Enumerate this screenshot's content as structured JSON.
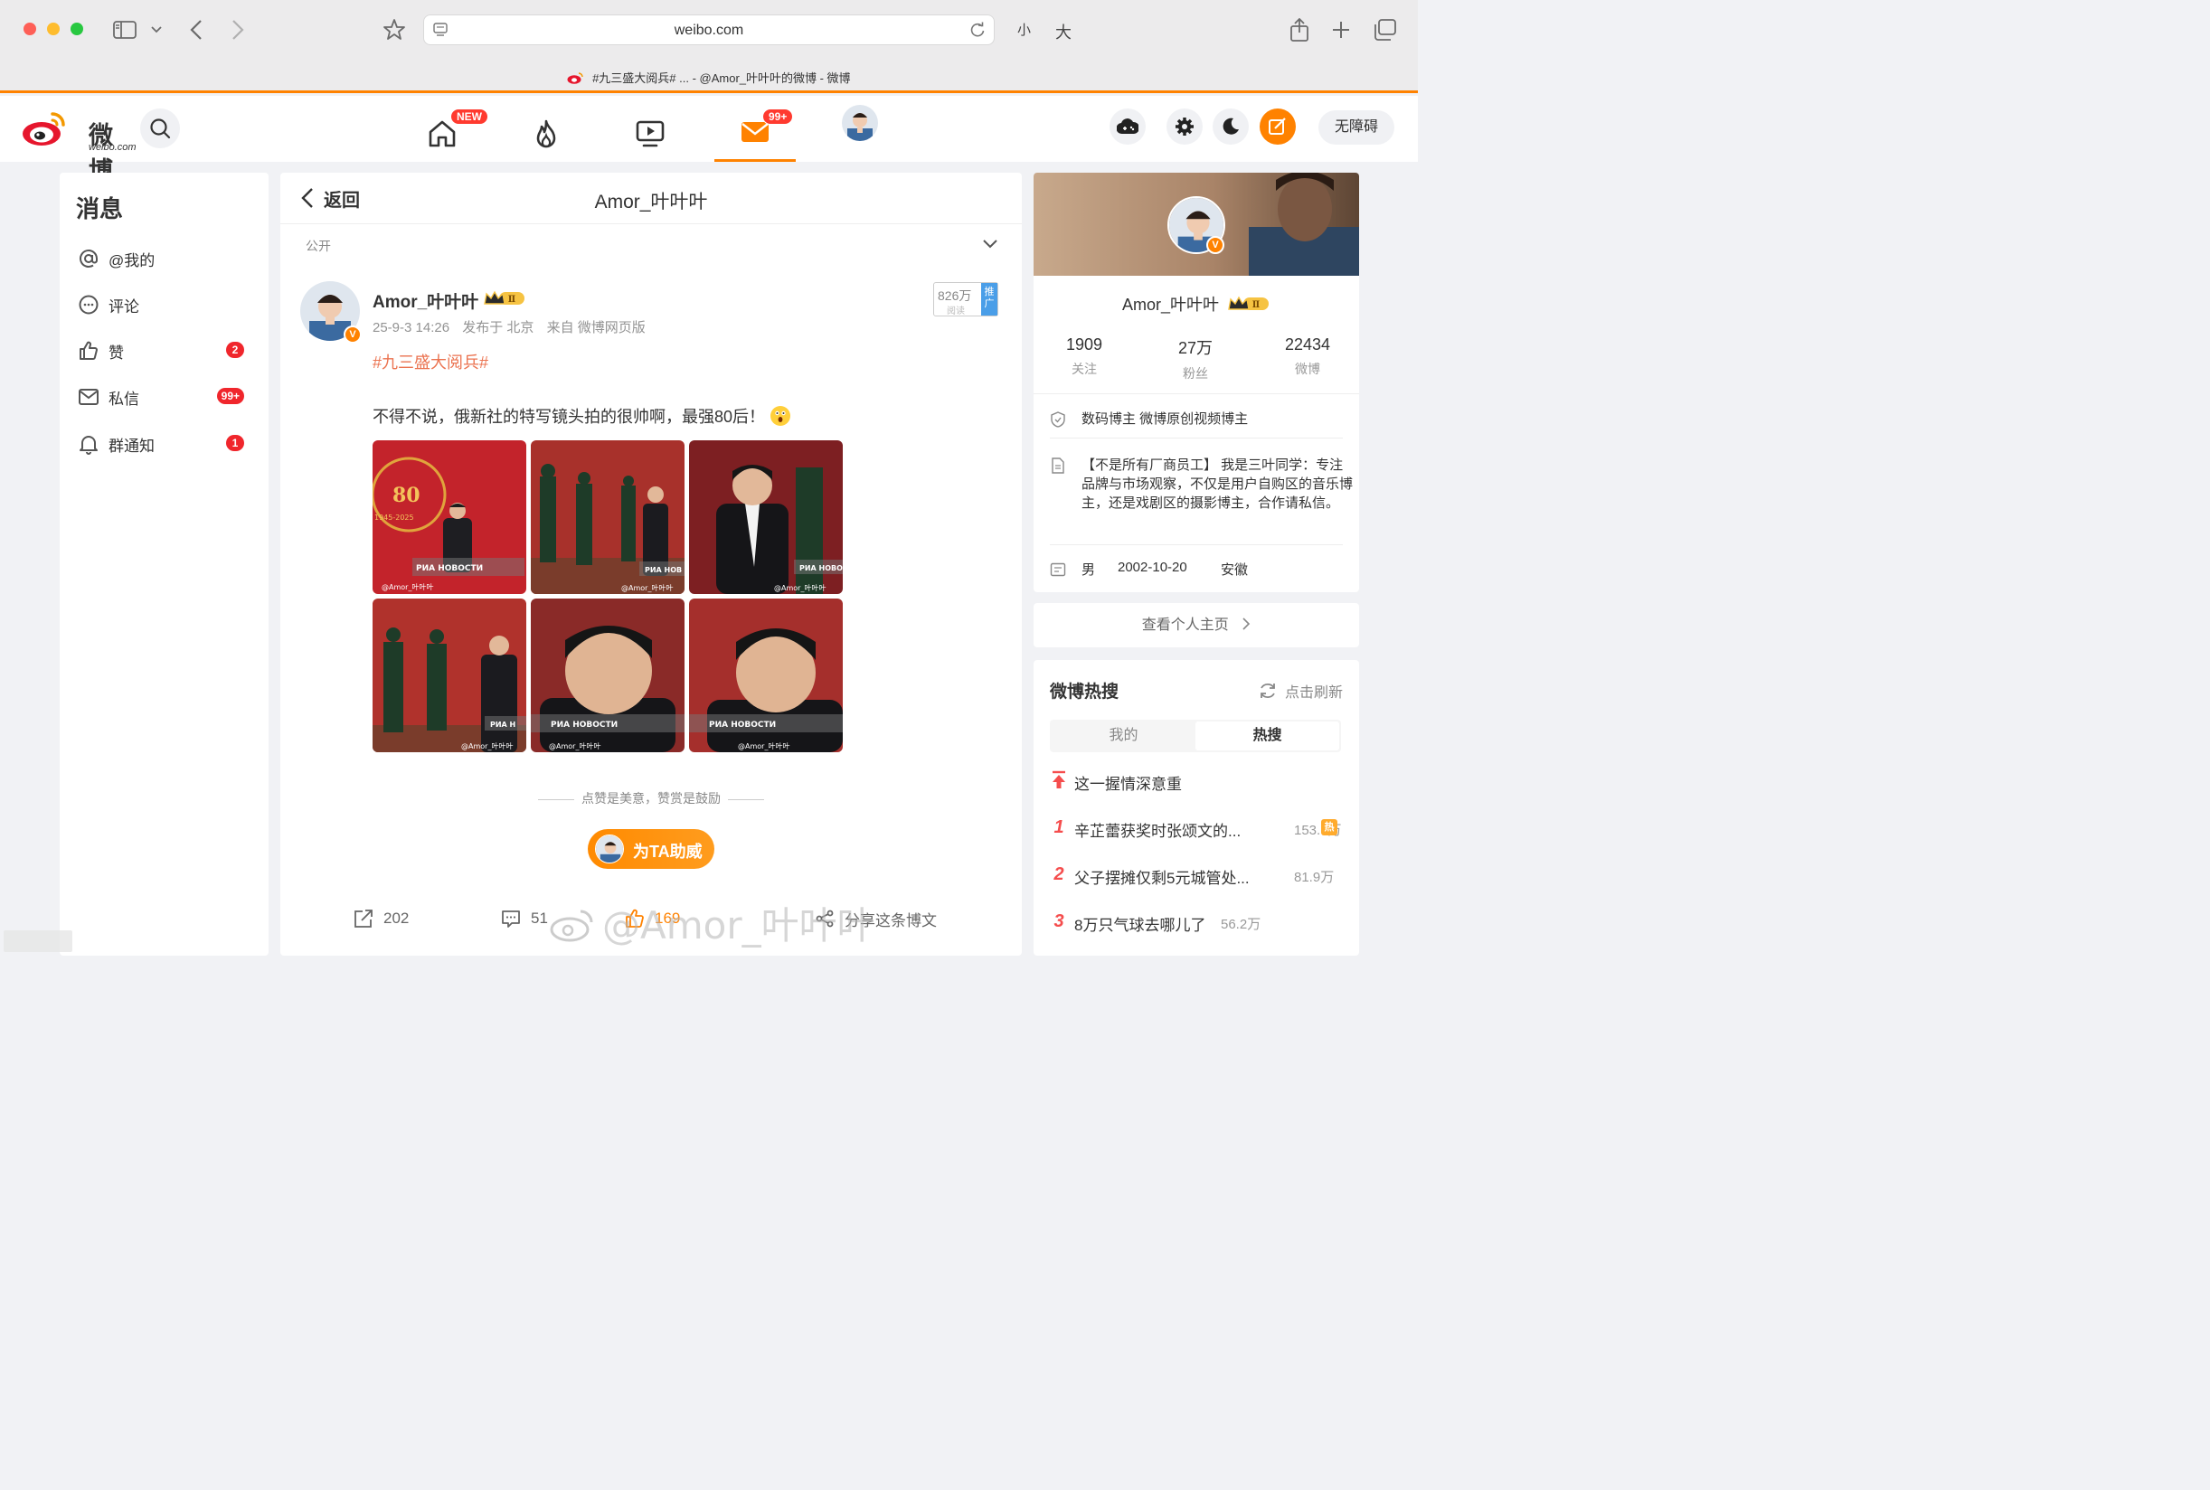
{
  "browser": {
    "url": "weibo.com",
    "tab_title": "#九三盛大阅兵# ... - @Amor_叶叶叶的微博 - 微博",
    "zoom_small_label": "小",
    "zoom_large_label": "大"
  },
  "topnav": {
    "logo_text": "微博",
    "logo_subtext": "weibo.com",
    "home_badge": "NEW",
    "messages_badge": "99+",
    "accessibility_label": "无障碍"
  },
  "sidebar": {
    "title": "消息",
    "items": [
      {
        "label": "@我的",
        "badge": ""
      },
      {
        "label": "评论",
        "badge": ""
      },
      {
        "label": "赞",
        "badge": "2"
      },
      {
        "label": "私信",
        "badge": "99+"
      },
      {
        "label": "群通知",
        "badge": "1"
      }
    ]
  },
  "center": {
    "back_label": "返回",
    "title": "Amor_叶叶叶",
    "visibility": "公开"
  },
  "post": {
    "author": "Amor_叶叶叶",
    "level_badge": "Ⅱ",
    "verified_mark": "V",
    "time": "25-9-3 14:26",
    "location": "发布于 北京",
    "source": "来自 微博网页版",
    "read_count": "826万",
    "read_label": "阅读",
    "promo_label": "推广",
    "hashtag": "#九三盛大阅兵#",
    "body": "不得不说，俄新社的特写镜头拍的很帅啊，最强80后！",
    "images": [
      {
        "watermark": "@Amor_叶叶叶",
        "source_mark": "РИА НОВОСТИ",
        "badge_text": "80",
        "year_text": "1945-2025"
      },
      {
        "watermark": "@Amor_叶叶叶",
        "source_mark": "РИА НОВ"
      },
      {
        "watermark": "@Amor_叶叶叶",
        "source_mark": "РИА НОВО"
      },
      {
        "watermark": "@Amor_叶叶叶",
        "source_mark": "РИА Н"
      },
      {
        "watermark": "@Amor_叶叶叶",
        "source_mark": "РИА НОВОСТИ"
      },
      {
        "watermark": "@Amor_叶叶叶",
        "source_mark": "РИА НОВОСТИ"
      }
    ],
    "reward_hint": "点赞是美意，赞赏是鼓励",
    "cheer_label": "为TA助威",
    "actions": {
      "reposts": "202",
      "comments": "51",
      "likes": "169",
      "share_label": "分享这条博文"
    },
    "overlay_watermark": "@Amor_叶叶叶"
  },
  "profile": {
    "name": "Amor_叶叶叶",
    "level_badge": "Ⅱ",
    "stats": [
      {
        "num": "1909",
        "label": "关注"
      },
      {
        "num": "27万",
        "label": "粉丝"
      },
      {
        "num": "22434",
        "label": "微博"
      }
    ],
    "certification": "数码博主 微博原创视频博主",
    "bio": "【不是所有厂商员工】 我是三叶同学：专注品牌与市场观察，不仅是用户自购区的音乐博主，还是戏剧区的摄影博主，合作请私信。",
    "gender": "男",
    "birthday": "2002-10-20",
    "region": "安徽",
    "view_profile_label": "查看个人主页"
  },
  "hot_search": {
    "title": "微博热搜",
    "refresh_label": "点击刷新",
    "tabs": [
      "我的",
      "热搜"
    ],
    "active_tab": "热搜",
    "pinned": "这一握情深意重",
    "items": [
      {
        "rank": "1",
        "text": "辛芷蕾获奖时张颂文的...",
        "count": "153.7万",
        "tag": "热"
      },
      {
        "rank": "2",
        "text": "父子摆摊仅剩5元城管处...",
        "count": "81.9万",
        "tag": ""
      },
      {
        "rank": "3",
        "text": "8万只气球去哪儿了",
        "count": "56.2万",
        "tag": ""
      }
    ]
  },
  "colors": {
    "brand_orange": "#ff8200",
    "badge_red": "#f0262c",
    "hashtag": "#eb7350",
    "hot_rank": "#f54d4d"
  }
}
